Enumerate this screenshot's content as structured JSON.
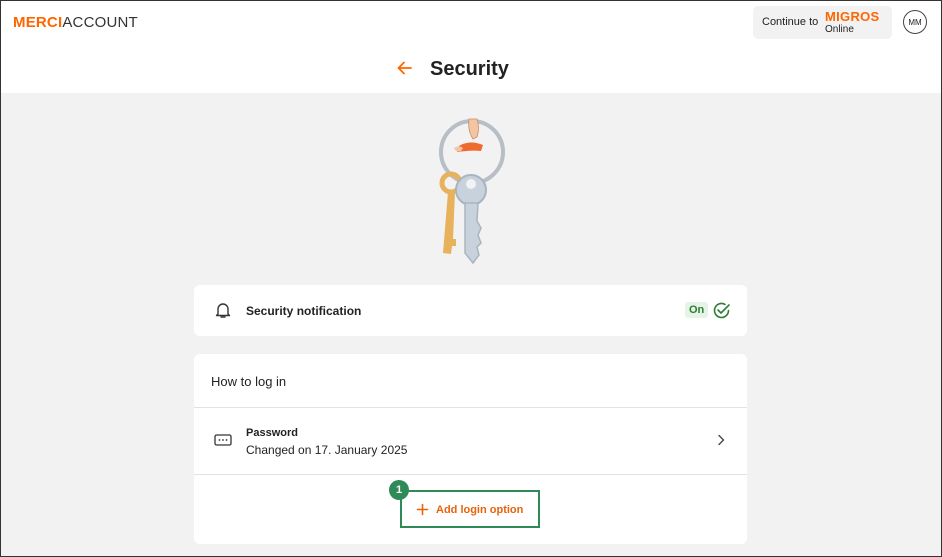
{
  "header": {
    "logo_primary": "MERCI",
    "logo_secondary": "ACCOUNT",
    "continue_label": "Continue to",
    "migros_brand": "MIGROS",
    "migros_sub": "Online",
    "avatar_initials": "MM"
  },
  "page": {
    "title": "Security"
  },
  "notification_card": {
    "label": "Security notification",
    "status": "On"
  },
  "login_card": {
    "title": "How to log in",
    "password": {
      "label": "Password",
      "changed": "Changed on 17. January 2025"
    },
    "add_option_label": "Add login option"
  },
  "annotation": {
    "step_number": "1"
  },
  "colors": {
    "brand_orange": "#ff6600",
    "accent_green": "#2e8b57",
    "on_badge_bg": "#e6f3e8",
    "page_bg": "#f2f2f2"
  },
  "icons": {
    "back": "arrow-left-icon",
    "notification": "bell-icon",
    "status": "check-circle-icon",
    "password": "password-field-icon",
    "chevron": "chevron-right-icon",
    "add": "plus-icon"
  }
}
